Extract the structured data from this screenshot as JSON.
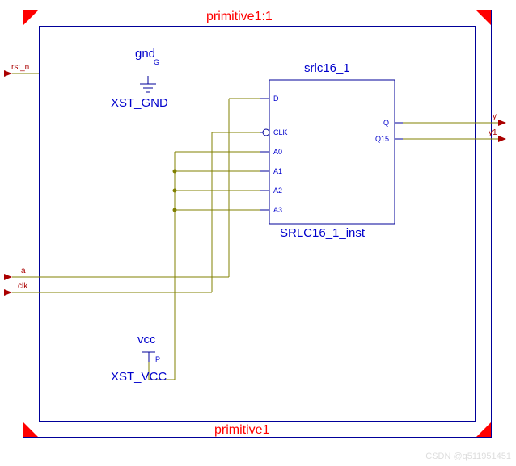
{
  "title_top": "primitive1:1",
  "title_bottom": "primitive1",
  "gnd": {
    "label": "gnd",
    "pin": "G",
    "name": "XST_GND"
  },
  "vcc": {
    "label": "vcc",
    "pin": "P",
    "name": "XST_VCC"
  },
  "srlc": {
    "label": "srlc16_1",
    "instance": "SRLC16_1_inst",
    "pins_left": [
      "D",
      "CLK",
      "A0",
      "A1",
      "A2",
      "A3"
    ],
    "pins_right": [
      "Q",
      "Q15"
    ]
  },
  "ports": {
    "rst_n": "rst_n",
    "a": "a",
    "clk": "clk",
    "y": "y",
    "y1": "y1"
  },
  "watermark": "CSDN @q511951451"
}
